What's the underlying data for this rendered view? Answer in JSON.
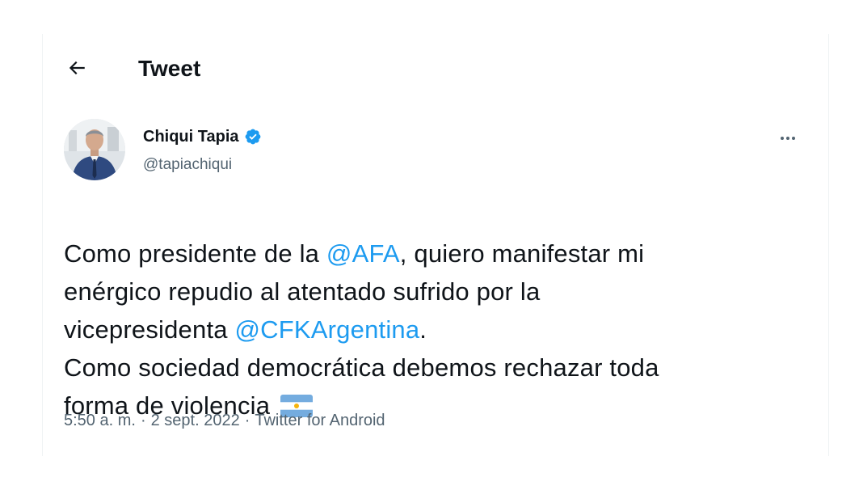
{
  "header": {
    "title": "Tweet",
    "back_icon": "arrow-left-icon"
  },
  "author": {
    "display_name": "Chiqui Tapia",
    "handle": "@tapiachiqui",
    "verified_icon": "verified-badge-icon",
    "verified_color": "#1d9bf0"
  },
  "tweet": {
    "line1_prefix": "Como presidente de la ",
    "mention_afa": "@AFA",
    "line1_suffix": ", quiero manifestar mi",
    "line2": "enérgico repudio al atentado sufrido por la",
    "line3_prefix": "vicepresidenta ",
    "mention_cfk": "@CFKArgentina",
    "line3_suffix": ".",
    "line4": "Como sociedad democrática debemos rechazar toda",
    "line5": "forma de violencia",
    "flag_icon": "argentina-flag-icon"
  },
  "meta": {
    "time": "5:50 a. m.",
    "separator": "·",
    "date": "2 sept. 2022",
    "source": "Twitter for Android"
  },
  "colors": {
    "link": "#1d9bf0",
    "secondary_text": "#536471",
    "primary_text": "#0f1419"
  }
}
